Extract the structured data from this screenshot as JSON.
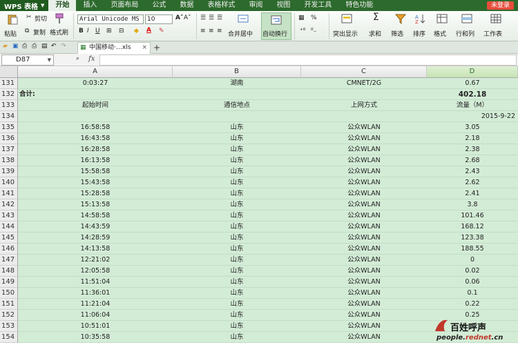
{
  "app": {
    "name": "WPS 表格",
    "login": "未登录"
  },
  "menu": [
    "开始",
    "插入",
    "页面布局",
    "公式",
    "数据",
    "表格样式",
    "审阅",
    "视图",
    "开发工具",
    "特色功能"
  ],
  "ribbon": {
    "paste": "粘贴",
    "cut": "剪切",
    "copy": "复制",
    "format_painter": "格式刷",
    "font_name": "Arial Unicode MS",
    "font_size": "10",
    "merge_center": "合并居中",
    "wrap_text": "自动换行",
    "percent": "%",
    "show": "突出显示",
    "sum": "求和",
    "filter": "筛选",
    "sort": "排序",
    "format": "格式",
    "rows_cols": "行和列",
    "worksheet": "工作表"
  },
  "tab": {
    "file_name": "中国移动·…xls"
  },
  "formula_bar": {
    "cell_ref": "D87",
    "fx": "fx",
    "value": ""
  },
  "columns": [
    "A",
    "B",
    "C",
    "D"
  ],
  "selected_column": "D",
  "rows": [
    {
      "num": "131",
      "a": "0:03:27",
      "b": "湖南",
      "c": "CMNET/2G",
      "d": "0.67"
    },
    {
      "num": "132",
      "a": "合计:",
      "b": "",
      "c": "",
      "d": "402.18",
      "a_left": true,
      "d_bold": true
    },
    {
      "num": "133",
      "a": "起始时间",
      "b": "通信地点",
      "c": "上网方式",
      "d": "流量（M）"
    },
    {
      "num": "134",
      "a": "",
      "b": "",
      "c": "",
      "d": "2015-9-22",
      "d_right": true
    },
    {
      "num": "135",
      "a": "16:58:58",
      "b": "山东",
      "c": "公众WLAN",
      "d": "3.05"
    },
    {
      "num": "136",
      "a": "16:43:58",
      "b": "山东",
      "c": "公众WLAN",
      "d": "2.18"
    },
    {
      "num": "137",
      "a": "16:28:58",
      "b": "山东",
      "c": "公众WLAN",
      "d": "2.38"
    },
    {
      "num": "138",
      "a": "16:13:58",
      "b": "山东",
      "c": "公众WLAN",
      "d": "2.68"
    },
    {
      "num": "139",
      "a": "15:58:58",
      "b": "山东",
      "c": "公众WLAN",
      "d": "2.43"
    },
    {
      "num": "140",
      "a": "15:43:58",
      "b": "山东",
      "c": "公众WLAN",
      "d": "2.62"
    },
    {
      "num": "141",
      "a": "15:28:58",
      "b": "山东",
      "c": "公众WLAN",
      "d": "2.41"
    },
    {
      "num": "142",
      "a": "15:13:58",
      "b": "山东",
      "c": "公众WLAN",
      "d": "3.8"
    },
    {
      "num": "143",
      "a": "14:58:58",
      "b": "山东",
      "c": "公众WLAN",
      "d": "101.46"
    },
    {
      "num": "144",
      "a": "14:43:59",
      "b": "山东",
      "c": "公众WLAN",
      "d": "168.12"
    },
    {
      "num": "145",
      "a": "14:28:59",
      "b": "山东",
      "c": "公众WLAN",
      "d": "123.38"
    },
    {
      "num": "146",
      "a": "14:13:58",
      "b": "山东",
      "c": "公众WLAN",
      "d": "188.55"
    },
    {
      "num": "147",
      "a": "12:21:02",
      "b": "山东",
      "c": "公众WLAN",
      "d": "0"
    },
    {
      "num": "148",
      "a": "12:05:58",
      "b": "山东",
      "c": "公众WLAN",
      "d": "0.02"
    },
    {
      "num": "149",
      "a": "11:51:04",
      "b": "山东",
      "c": "公众WLAN",
      "d": "0.06"
    },
    {
      "num": "150",
      "a": "11:36:01",
      "b": "山东",
      "c": "公众WLAN",
      "d": "0.1"
    },
    {
      "num": "151",
      "a": "11:21:04",
      "b": "山东",
      "c": "公众WLAN",
      "d": "0.22"
    },
    {
      "num": "152",
      "a": "11:06:04",
      "b": "山东",
      "c": "公众WLAN",
      "d": "0.25"
    },
    {
      "num": "153",
      "a": "10:51:01",
      "b": "山东",
      "c": "公众WLAN",
      "d": ""
    },
    {
      "num": "154",
      "a": "10:35:58",
      "b": "山东",
      "c": "公众WLAN",
      "d": ""
    }
  ],
  "watermark": {
    "title": "百姓呼声",
    "url_prefix": "people.",
    "url_red": "rednet",
    "url_suffix": ".cn"
  },
  "colors": {
    "menubar": "#2d6a2d",
    "cell_fill": "#d3ecd6",
    "login": "#e74c3c"
  }
}
